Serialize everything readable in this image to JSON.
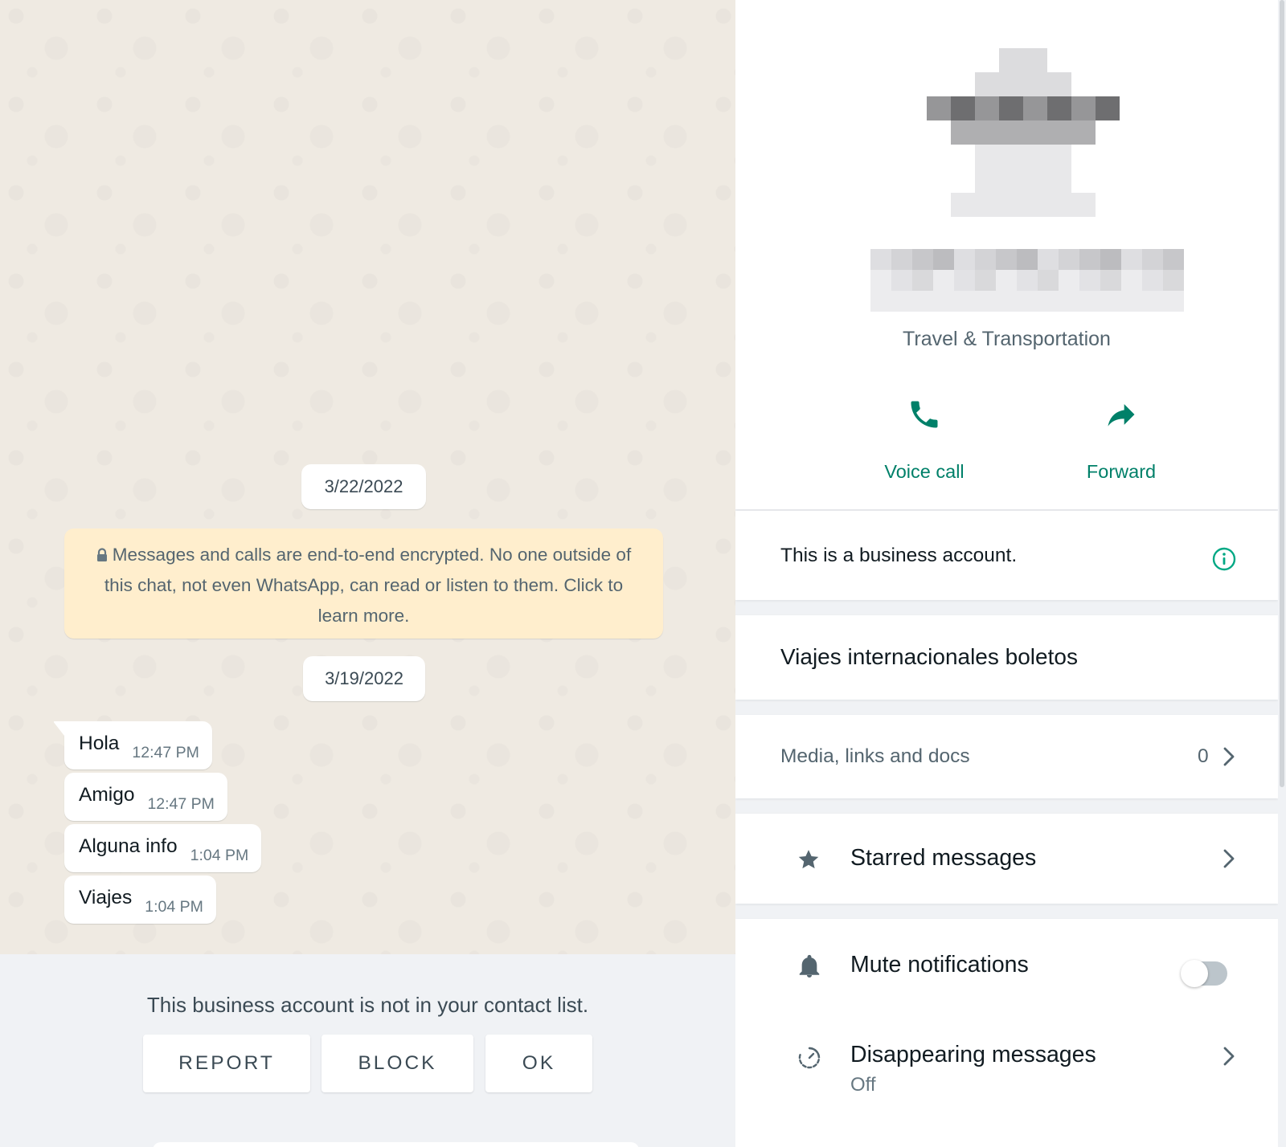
{
  "chat": {
    "date_chip_1": "3/22/2022",
    "encryption_notice": "Messages and calls are end-to-end encrypted. No one outside of this chat, not even WhatsApp, can read or listen to them. Click to learn more.",
    "date_chip_2": "3/19/2022",
    "messages": [
      {
        "text": "Hola",
        "time": "12:47 PM"
      },
      {
        "text": "Amigo",
        "time": "12:47 PM"
      },
      {
        "text": "Alguna info",
        "time": "1:04 PM"
      },
      {
        "text": "Viajes",
        "time": "1:04 PM"
      }
    ],
    "footer": {
      "notice": "This business account is not in your contact list.",
      "report_label": "REPORT",
      "block_label": "BLOCK",
      "ok_label": "OK"
    }
  },
  "contact": {
    "category": "Travel & Transportation",
    "voice_call_label": "Voice call",
    "forward_label": "Forward",
    "business_notice": "This is a business account.",
    "description": "Viajes internacionales boletos",
    "media_label": "Media, links and docs",
    "media_count": "0",
    "starred_label": "Starred messages",
    "mute_label": "Mute notifications",
    "mute_enabled": false,
    "disappearing_label": "Disappearing messages",
    "disappearing_value": "Off"
  },
  "colors": {
    "accent": "#008069",
    "chat_background": "#efeae2",
    "encryption_banner": "#ffeecd",
    "panel_background": "#f0f2f5"
  },
  "icons": [
    "lock-icon",
    "phone-icon",
    "forward-arrow-icon",
    "info-icon",
    "chevron-right-icon",
    "star-icon",
    "bell-icon",
    "timer-icon"
  ]
}
